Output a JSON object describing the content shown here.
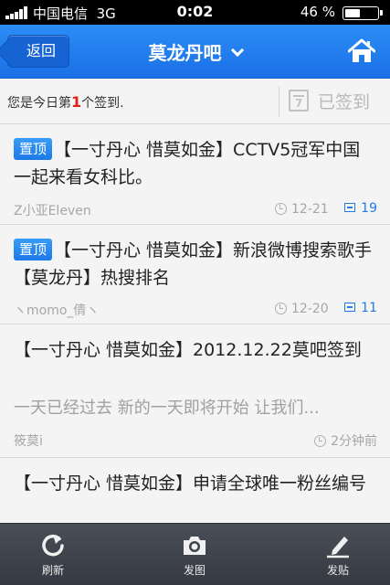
{
  "status_bar": {
    "carrier": "中国电信",
    "network": "3G",
    "time": "0:02",
    "battery_percent": "46",
    "battery_label": "46 %"
  },
  "nav": {
    "back_label": "返回",
    "title": "莫龙丹吧",
    "home_icon": "home-icon",
    "dropdown_icon": "chevron-down-icon"
  },
  "sign_in": {
    "message_prefix": "您是今日第",
    "rank": "1",
    "message_suffix": "个签到.",
    "signed_label": "已签到",
    "signed_icon": "calendar-icon"
  },
  "posts": [
    {
      "pinned_label": "置顶",
      "title": "【一寸丹心 惜莫如金】CCTV5冠军中国 一起来看女科比。",
      "author": "Z小亚Eleven",
      "time": "12-21",
      "replies": "19"
    },
    {
      "pinned_label": "置顶",
      "title": "【一寸丹心 惜莫如金】新浪微博搜索歌手【莫龙丹】热搜排名",
      "author": "ヽmomo_倩ヽ",
      "time": "12-20",
      "replies": "11"
    },
    {
      "title": "【一寸丹心 惜莫如金】2012.12.22莫吧签到",
      "excerpt": "一天已经过去 新的一天即将开始 让我们...",
      "author": "筱莫i",
      "time": "2分钟前"
    },
    {
      "title": "【一寸丹心 惜莫如金】申请全球唯一粉丝编号"
    }
  ],
  "tab_bar": [
    {
      "label": "刷新",
      "icon": "refresh-icon"
    },
    {
      "label": "发图",
      "icon": "camera-icon"
    },
    {
      "label": "发贴",
      "icon": "compose-icon"
    }
  ],
  "colors": {
    "nav_blue": "#1a70e6",
    "pin_blue": "#1d79e8",
    "rank_red": "#e0201a",
    "tabbar_dark": "#353941"
  }
}
